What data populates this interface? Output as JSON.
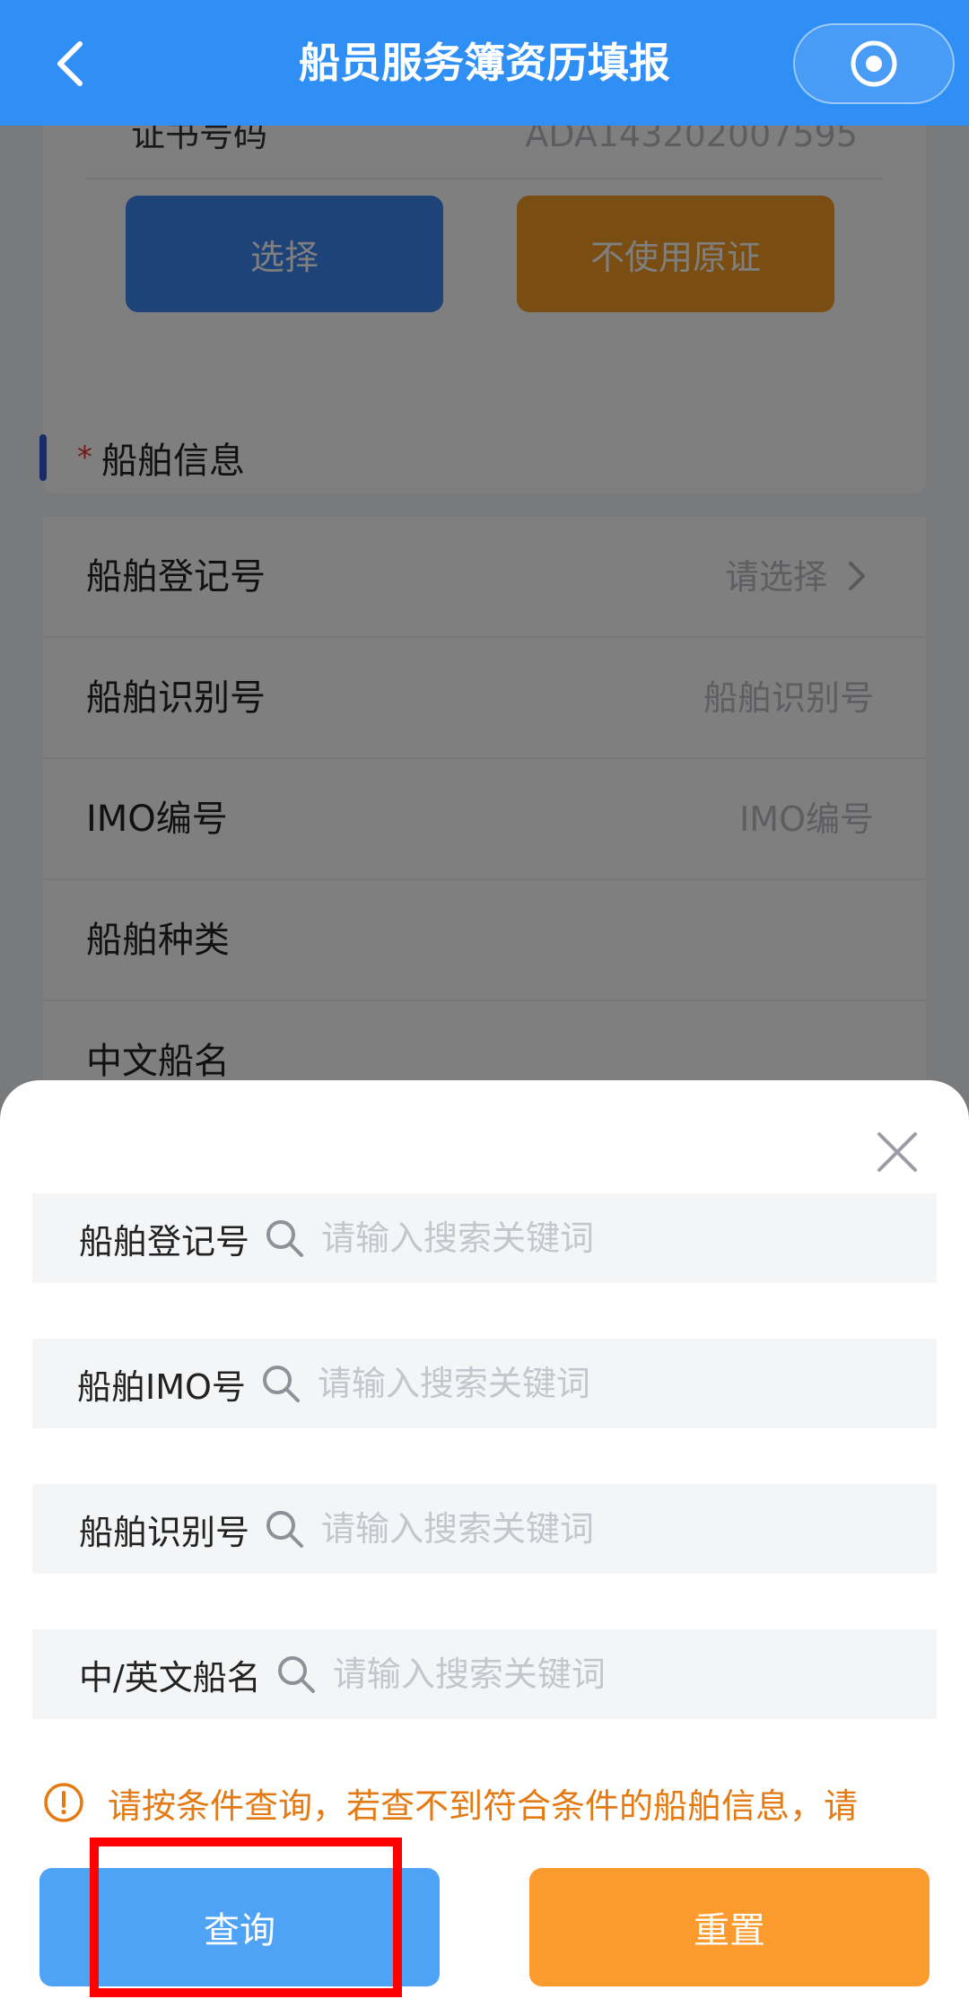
{
  "header": {
    "title": "船员服务簿资历填报",
    "back_icon": "chevron-left-icon",
    "capsule_icon": "target-icon"
  },
  "certificate": {
    "label": "证书号码",
    "value": "ADA143202007595",
    "select_button": "选择",
    "no_original_button": "不使用原证"
  },
  "ship_section": {
    "required_mark": "*",
    "title": "船舶信息",
    "rows": [
      {
        "label": "船舶登记号",
        "value": "请选择",
        "has_chevron": true
      },
      {
        "label": "船舶识别号",
        "value": "船舶识别号"
      },
      {
        "label": "IMO编号",
        "value": "IMO编号"
      },
      {
        "label": "船舶种类",
        "value": ""
      },
      {
        "label": "中文船名",
        "value": ""
      }
    ]
  },
  "search_sheet": {
    "close_icon": "close-icon",
    "fields": [
      {
        "label": "船舶登记号",
        "placeholder": "请输入搜索关键词",
        "value": ""
      },
      {
        "label": "船舶IMO号",
        "placeholder": "请输入搜索关键词",
        "value": ""
      },
      {
        "label": "船舶识别号",
        "placeholder": "请输入搜索关键词",
        "value": ""
      },
      {
        "label": "中/英文船名",
        "placeholder": "请输入搜索关键词",
        "value": ""
      }
    ],
    "notice": "请按条件查询，若查不到符合条件的船舶信息，请",
    "query_button": "查询",
    "reset_button": "重置"
  },
  "colors": {
    "header_bg": "#2f8ff5",
    "query_button": "#4fa3f7",
    "reset_button": "#fb9a2d",
    "notice_text": "#e47a14",
    "highlight_box": "#ff0000"
  }
}
